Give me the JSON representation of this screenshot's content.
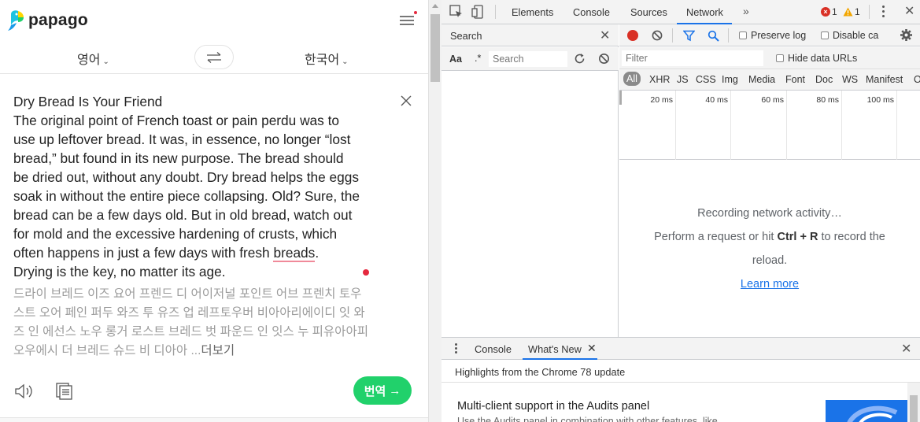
{
  "papago": {
    "logo_text": "papago",
    "source_lang": "영어",
    "target_lang": "한국어",
    "source_lines": [
      "Dry Bread Is Your Friend",
      "The original point of French toast or pain perdu was to",
      "use up leftover bread. It was, in essence, no longer “lost",
      "bread,” but found in its new purpose. The bread should",
      "be dried out, without any doubt. Dry bread helps the eggs",
      "soak in without the entire piece collapsing. Old? Sure, the",
      "bread can be a few days old. But in old bread, watch out",
      "for mold and the excessive hardening of crusts, which",
      "often happens in just a few days with fresh ",
      "breads",
      ".",
      "Drying is the key, no matter its age."
    ],
    "pronunciation_lines": [
      "드라이 브레드 이즈 요어 프렌드 디 어이저널 포인트 어브 프렌치 토우",
      "스트 오어 페인 퍼두 와즈 투 유즈 업 레프토우버 비아아리에이디 잇 와",
      "즈 인 에선스 노우 롱거 로스트 브레드 벗 파운드 인 잇스 누 피유아아피",
      "오우에시 더 브레드 슈드 비 디아아 ...",
      "더보기"
    ],
    "translate_button": "번역"
  },
  "devtools": {
    "tabs": [
      "Elements",
      "Console",
      "Sources",
      "Network"
    ],
    "active_tab": "Network",
    "more_tabs": "»",
    "error_count": "1",
    "warning_count": "1",
    "search_panel": {
      "title": "Search",
      "case_toggle": "Aa",
      "regex_toggle": ".*",
      "placeholder": "Search"
    },
    "network": {
      "preserve_log": "Preserve log",
      "disable_cache": "Disable ca",
      "filter_placeholder": "Filter",
      "hide_data_urls": "Hide data URLs",
      "types": [
        "All",
        "XHR",
        "JS",
        "CSS",
        "Img",
        "Media",
        "Font",
        "Doc",
        "WS",
        "Manifest",
        "O"
      ],
      "timeline_ticks": [
        "20 ms",
        "40 ms",
        "60 ms",
        "80 ms",
        "100 ms"
      ],
      "empty_line1": "Recording network activity…",
      "empty_line2_a": "Perform a request or hit ",
      "empty_line2_key": "Ctrl + R",
      "empty_line2_b": " to record the",
      "empty_line3": "reload.",
      "learn_more": "Learn more"
    },
    "drawer": {
      "tabs": [
        "Console",
        "What's New"
      ],
      "active_tab": "What's New",
      "highlights": "Highlights from the Chrome 78 update",
      "card_title": "Multi-client support in the Audits panel",
      "card_sub": "Use the Audits panel in combination with other features, like"
    }
  },
  "colors": {
    "papago_green": "#21d16b",
    "accent_blue": "#1a73e8",
    "record_red": "#d93025",
    "warning_yellow": "#f2a600"
  }
}
